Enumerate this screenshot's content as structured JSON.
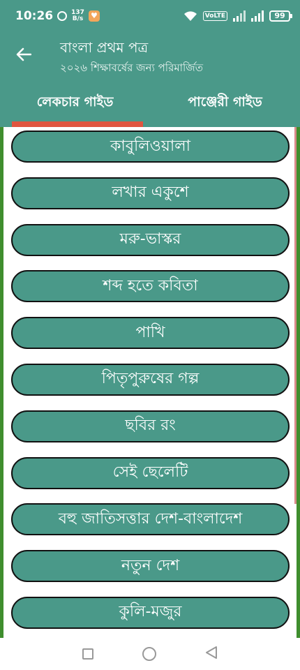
{
  "status": {
    "time": "10:26",
    "speed_value": "137",
    "speed_unit": "B/s",
    "volte": "VoLTE",
    "battery": "99"
  },
  "appbar": {
    "title": "বাংলা প্রথম পত্র",
    "subtitle": "২০২৬ শিক্ষাবর্ষের জন্য পরিমার্জিত"
  },
  "tabs": [
    {
      "label": "লেকচার গাইড",
      "active": true
    },
    {
      "label": "পাঞ্জেরী গাইড",
      "active": false
    }
  ],
  "items": [
    "কাবুলিওয়ালা",
    "লখার একুশে",
    "মরু-ভাস্কর",
    "শব্দ হতে কবিতা",
    "পাখি",
    "পিতৃপুরুষের গল্প",
    "ছবির রং",
    "সেই ছেলেটি",
    "বহু জাতিসত্তার দেশ-বাংলাদেশ",
    "নতুন দেশ",
    "কুলি-মজুর"
  ],
  "colors": {
    "primary": "#4a9989",
    "tab_indicator": "#e0553f",
    "side_border": "#3f8e2e"
  },
  "icons": {
    "back": "arrow-left-icon",
    "nav": [
      "recents-square-icon",
      "home-circle-icon",
      "back-triangle-icon"
    ]
  }
}
